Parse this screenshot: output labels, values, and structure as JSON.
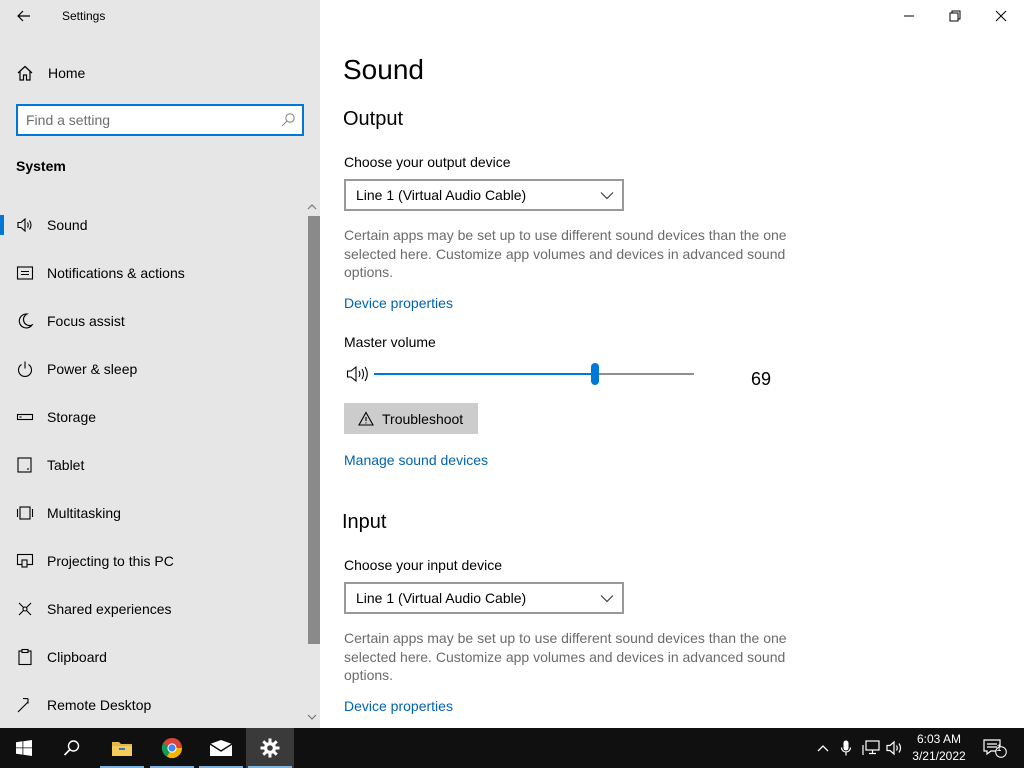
{
  "window": {
    "app_title": "Settings",
    "controls": [
      "minimize",
      "maximize",
      "close"
    ]
  },
  "sidebar": {
    "home_label": "Home",
    "search": {
      "placeholder": "Find a setting",
      "value": ""
    },
    "section_label": "System",
    "items": [
      {
        "label": "Sound",
        "icon": "speaker-icon",
        "selected": true
      },
      {
        "label": "Notifications & actions",
        "icon": "notification-icon",
        "selected": false
      },
      {
        "label": "Focus assist",
        "icon": "moon-icon",
        "selected": false
      },
      {
        "label": "Power & sleep",
        "icon": "power-icon",
        "selected": false
      },
      {
        "label": "Storage",
        "icon": "storage-icon",
        "selected": false
      },
      {
        "label": "Tablet",
        "icon": "tablet-icon",
        "selected": false
      },
      {
        "label": "Multitasking",
        "icon": "multitasking-icon",
        "selected": false
      },
      {
        "label": "Projecting to this PC",
        "icon": "projecting-icon",
        "selected": false
      },
      {
        "label": "Shared experiences",
        "icon": "shared-experiences-icon",
        "selected": false
      },
      {
        "label": "Clipboard",
        "icon": "clipboard-icon",
        "selected": false
      },
      {
        "label": "Remote Desktop",
        "icon": "remote-desktop-icon",
        "selected": false
      }
    ]
  },
  "main": {
    "title": "Sound",
    "output": {
      "heading": "Output",
      "device_label": "Choose your output device",
      "device_value": "Line 1 (Virtual Audio Cable)",
      "helper_line1": "Certain apps may be set up to use different sound devices than the one",
      "helper_line2": "selected here. Customize app volumes and devices in advanced sound",
      "helper_line3": "options.",
      "device_properties_link": "Device properties",
      "volume_label": "Master volume",
      "volume_value": 69,
      "troubleshoot_label": "Troubleshoot",
      "manage_devices_link": "Manage sound devices"
    },
    "input": {
      "heading": "Input",
      "device_label": "Choose your input device",
      "device_value": "Line 1 (Virtual Audio Cable)",
      "helper_line1": "Certain apps may be set up to use different sound devices than the one",
      "helper_line2": "selected here. Customize app volumes and devices in advanced sound",
      "helper_line3": "options.",
      "device_properties_link": "Device properties"
    }
  },
  "taskbar": {
    "apps": [
      "start-icon",
      "search-icon",
      "file-explorer-icon",
      "chrome-icon",
      "mail-icon",
      "settings-icon"
    ],
    "tray": [
      "chevron-up-icon",
      "microphone-icon",
      "network-icon",
      "volume-icon"
    ],
    "time": "6:03 AM",
    "date": "3/21/2022",
    "notification_count": "1"
  },
  "colors": {
    "accent": "#0078d7",
    "link": "#0063b1",
    "sidebar_bg": "#e6e6e6",
    "taskbar_bg": "#101010"
  }
}
